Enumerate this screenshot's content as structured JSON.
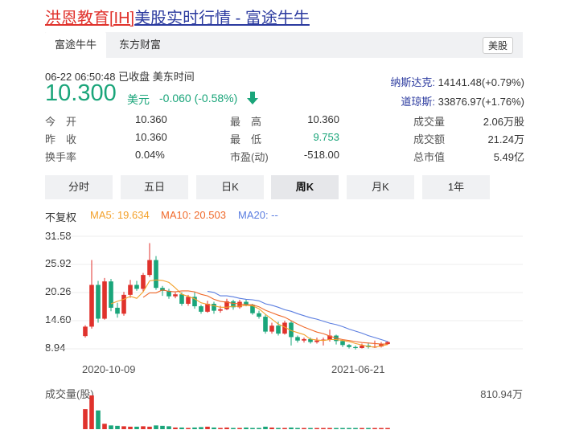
{
  "title": {
    "part1": "洪恩教育[IH]",
    "part2": "美股实时行情 - 富途牛牛"
  },
  "tabs": [
    "富途牛牛",
    "东方财富"
  ],
  "market_tag": "美股",
  "quote": {
    "time": "06-22 06:50:48",
    "status": "已收盘",
    "tz": "美东时间",
    "price": "10.300",
    "currency": "美元",
    "change": "-0.060",
    "change_pct": "(-0.58%)"
  },
  "indices": [
    {
      "name": "纳斯达克:",
      "value": "14141.48(+0.79%)"
    },
    {
      "name": "道琼斯:",
      "value": "33876.97(+1.76%)"
    }
  ],
  "stats": [
    [
      {
        "label": "今　开",
        "value": "10.360"
      },
      {
        "label": "最　高",
        "value": "10.360"
      },
      {
        "label": "成交量",
        "value": "2.06万股"
      }
    ],
    [
      {
        "label": "昨　收",
        "value": "10.360"
      },
      {
        "label": "最　低",
        "value": "9.753",
        "color": "#1aa57a"
      },
      {
        "label": "成交额",
        "value": "21.24万"
      }
    ],
    [
      {
        "label": "换手率",
        "value": "0.04%"
      },
      {
        "label": "市盈(动)",
        "value": "-518.00"
      },
      {
        "label": "总市值",
        "value": "5.49亿"
      }
    ]
  ],
  "periods": [
    "分时",
    "五日",
    "日K",
    "周K",
    "月K",
    "1年"
  ],
  "active_period": "周K",
  "indicators": {
    "adj": "不复权",
    "ma5": "MA5: 19.634",
    "ma10": "MA10: 20.503",
    "ma20": "MA20: --"
  },
  "colors": {
    "up": "#e0322c",
    "down": "#1aa57a",
    "ma5": "#f3a12b",
    "ma10": "#f06a2b",
    "ma20": "#5a7de0"
  },
  "chart_data": {
    "type": "candlestick",
    "y_ticks": [
      "31.58",
      "25.92",
      "20.26",
      "14.60",
      "8.94"
    ],
    "ylim": [
      8.94,
      31.58
    ],
    "x_labels": [
      "2020-10-09",
      "2021-06-21"
    ],
    "candles": [
      {
        "o": 11.5,
        "c": 13.4,
        "h": 13.7,
        "l": 11.2
      },
      {
        "o": 13.4,
        "c": 21.8,
        "h": 26.8,
        "l": 13.0
      },
      {
        "o": 21.8,
        "c": 15.0,
        "h": 22.6,
        "l": 14.2
      },
      {
        "o": 15.0,
        "c": 22.5,
        "h": 23.2,
        "l": 14.8
      },
      {
        "o": 22.5,
        "c": 17.2,
        "h": 23.0,
        "l": 16.5
      },
      {
        "o": 17.2,
        "c": 16.0,
        "h": 18.2,
        "l": 15.2
      },
      {
        "o": 16.0,
        "c": 19.8,
        "h": 20.4,
        "l": 15.6
      },
      {
        "o": 19.8,
        "c": 21.8,
        "h": 22.8,
        "l": 19.2
      },
      {
        "o": 21.8,
        "c": 21.0,
        "h": 22.6,
        "l": 20.6
      },
      {
        "o": 21.0,
        "c": 23.8,
        "h": 24.2,
        "l": 20.4
      },
      {
        "o": 23.8,
        "c": 26.8,
        "h": 30.2,
        "l": 23.4
      },
      {
        "o": 26.8,
        "c": 21.2,
        "h": 27.6,
        "l": 20.8
      },
      {
        "o": 21.2,
        "c": 20.6,
        "h": 21.6,
        "l": 19.6
      },
      {
        "o": 20.6,
        "c": 19.5,
        "h": 21.0,
        "l": 19.0
      },
      {
        "o": 19.5,
        "c": 19.9,
        "h": 20.3,
        "l": 19.1
      },
      {
        "o": 19.9,
        "c": 18.0,
        "h": 20.3,
        "l": 17.6
      },
      {
        "o": 18.0,
        "c": 19.4,
        "h": 19.8,
        "l": 17.6
      },
      {
        "o": 19.4,
        "c": 17.5,
        "h": 20.3,
        "l": 17.0
      },
      {
        "o": 17.5,
        "c": 16.4,
        "h": 17.8,
        "l": 16.0
      },
      {
        "o": 16.4,
        "c": 18.0,
        "h": 18.6,
        "l": 16.2
      },
      {
        "o": 18.0,
        "c": 16.6,
        "h": 18.4,
        "l": 16.0
      },
      {
        "o": 16.6,
        "c": 16.9,
        "h": 17.6,
        "l": 16.2
      },
      {
        "o": 16.9,
        "c": 18.5,
        "h": 19.0,
        "l": 16.7
      },
      {
        "o": 18.5,
        "c": 17.3,
        "h": 18.8,
        "l": 16.8
      },
      {
        "o": 17.3,
        "c": 18.4,
        "h": 18.8,
        "l": 17.0
      },
      {
        "o": 18.4,
        "c": 17.8,
        "h": 18.8,
        "l": 17.5
      },
      {
        "o": 17.8,
        "c": 16.1,
        "h": 18.0,
        "l": 15.8
      },
      {
        "o": 16.1,
        "c": 15.4,
        "h": 16.6,
        "l": 15.0
      },
      {
        "o": 15.4,
        "c": 12.4,
        "h": 15.8,
        "l": 12.0
      },
      {
        "o": 12.4,
        "c": 13.6,
        "h": 14.2,
        "l": 12.0
      },
      {
        "o": 13.6,
        "c": 12.0,
        "h": 14.4,
        "l": 11.6
      },
      {
        "o": 12.0,
        "c": 14.2,
        "h": 14.6,
        "l": 11.8
      },
      {
        "o": 14.2,
        "c": 11.3,
        "h": 14.5,
        "l": 9.6
      },
      {
        "o": 11.3,
        "c": 10.6,
        "h": 11.6,
        "l": 10.2
      },
      {
        "o": 10.6,
        "c": 10.9,
        "h": 11.2,
        "l": 10.2
      },
      {
        "o": 10.9,
        "c": 10.3,
        "h": 11.2,
        "l": 10.0
      },
      {
        "o": 10.3,
        "c": 10.6,
        "h": 11.2,
        "l": 10.0
      },
      {
        "o": 10.6,
        "c": 10.8,
        "h": 11.2,
        "l": 9.6
      },
      {
        "o": 10.8,
        "c": 11.6,
        "h": 12.8,
        "l": 10.4
      },
      {
        "o": 11.6,
        "c": 10.5,
        "h": 11.8,
        "l": 9.8
      },
      {
        "o": 10.5,
        "c": 9.7,
        "h": 10.8,
        "l": 9.3
      },
      {
        "o": 9.7,
        "c": 9.3,
        "h": 9.9,
        "l": 9.0
      },
      {
        "o": 9.3,
        "c": 9.1,
        "h": 9.6,
        "l": 8.8
      },
      {
        "o": 9.1,
        "c": 9.6,
        "h": 10.0,
        "l": 9.0
      },
      {
        "o": 9.6,
        "c": 9.3,
        "h": 10.2,
        "l": 9.0
      },
      {
        "o": 9.3,
        "c": 9.4,
        "h": 10.6,
        "l": 9.1
      },
      {
        "o": 9.4,
        "c": 9.9,
        "h": 10.3,
        "l": 9.2
      },
      {
        "o": 9.9,
        "c": 10.3,
        "h": 10.5,
        "l": 9.75
      }
    ],
    "ma5": [
      null,
      null,
      null,
      null,
      18.0,
      18.5,
      18.9,
      19.5,
      19.1,
      20.4,
      22.6,
      22.8,
      22.7,
      22.3,
      21.2,
      19.9,
      19.5,
      19.0,
      18.2,
      17.9,
      17.6,
      17.3,
      17.3,
      17.5,
      17.5,
      17.7,
      17.6,
      17.0,
      15.9,
      14.9,
      13.9,
      13.3,
      12.6,
      12.2,
      11.8,
      10.9,
      10.7,
      10.6,
      10.8,
      10.8,
      10.6,
      10.4,
      10.0,
      9.7,
      9.4,
      9.3,
      9.5,
      9.8
    ],
    "ma10": [
      null,
      null,
      null,
      null,
      null,
      null,
      null,
      null,
      null,
      19.3,
      20.2,
      20.2,
      20.8,
      20.5,
      20.4,
      20.6,
      20.6,
      20.4,
      19.9,
      19.6,
      18.9,
      18.5,
      18.3,
      18.1,
      18.0,
      17.8,
      17.8,
      17.4,
      16.7,
      16.2,
      15.7,
      15.3,
      14.6,
      13.9,
      13.3,
      12.8,
      12.3,
      12.0,
      11.5,
      11.1,
      10.8,
      10.6,
      10.4,
      10.2,
      10.1,
      10.0,
      9.9,
      9.9
    ],
    "ma20": [
      null,
      null,
      null,
      null,
      null,
      null,
      null,
      null,
      null,
      null,
      null,
      null,
      null,
      null,
      null,
      null,
      null,
      null,
      null,
      20.5,
      20.3,
      19.6,
      19.6,
      19.4,
      19.1,
      18.9,
      18.8,
      18.6,
      18.0,
      17.7,
      17.3,
      16.8,
      16.5,
      16.0,
      15.6,
      15.2,
      14.9,
      14.5,
      14.1,
      13.8,
      13.4,
      12.9,
      12.5,
      12.1,
      11.6,
      11.2,
      10.8,
      10.4
    ],
    "volume_label": "成交量(股)",
    "volume_max": "810.94万",
    "volume": [
      480,
      810,
      450,
      130,
      90,
      80,
      70,
      60,
      60,
      70,
      60,
      90,
      80,
      70,
      40,
      40,
      30,
      40,
      50,
      60,
      40,
      30,
      40,
      30,
      30,
      40,
      30,
      30,
      60,
      40,
      30,
      30,
      40,
      30,
      20,
      20,
      20,
      20,
      30,
      20,
      20,
      20,
      20,
      20,
      20,
      20,
      20,
      20
    ]
  }
}
